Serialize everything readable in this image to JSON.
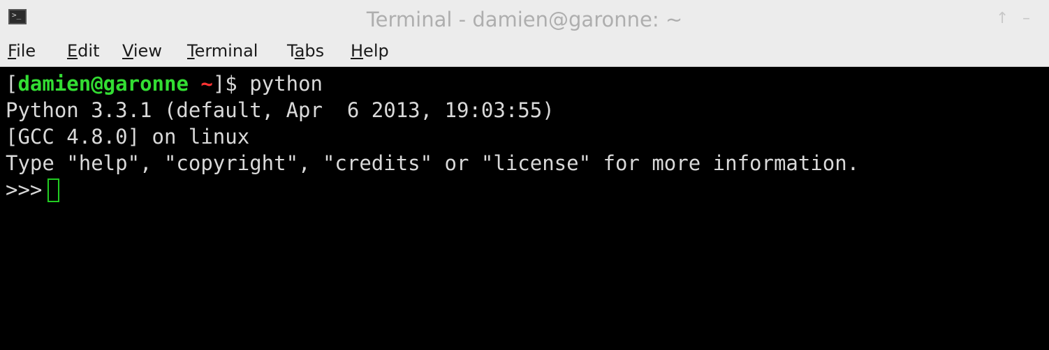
{
  "window": {
    "title": "Terminal - damien@garonne: ~",
    "app_icon": "terminal-icon",
    "icon_glyph": ">_",
    "maximize_glyph": "↑",
    "minimize_glyph": "–"
  },
  "menu": {
    "items": [
      {
        "label": "File",
        "mnemonic": "F",
        "rest": "ile"
      },
      {
        "label": "Edit",
        "mnemonic": "E",
        "rest": "dit"
      },
      {
        "label": "View",
        "mnemonic": "V",
        "rest": "iew"
      },
      {
        "label": "Terminal",
        "mnemonic": "T",
        "rest": "erminal"
      },
      {
        "label": "Tabs",
        "pre": "T",
        "mnemonic": "a",
        "rest": "bs"
      },
      {
        "label": "Help",
        "mnemonic": "H",
        "rest": "elp"
      }
    ]
  },
  "terminal": {
    "prompt": {
      "open_bracket": "[",
      "user_host": "damien@garonne",
      "space": " ",
      "cwd": "~",
      "close": "]$ ",
      "command": "python"
    },
    "output_lines": [
      "Python 3.3.1 (default, Apr  6 2013, 19:03:55)",
      "[GCC 4.8.0] on linux",
      "Type \"help\", \"copyright\", \"credits\" or \"license\" for more information."
    ],
    "repl_prompt": ">>>"
  },
  "colors": {
    "background": "#000000",
    "foreground": "#d9d9d9",
    "prompt_user": "#33dd33",
    "prompt_cwd": "#ff3333",
    "cursor": "#22cc22",
    "chrome": "#ececec"
  }
}
